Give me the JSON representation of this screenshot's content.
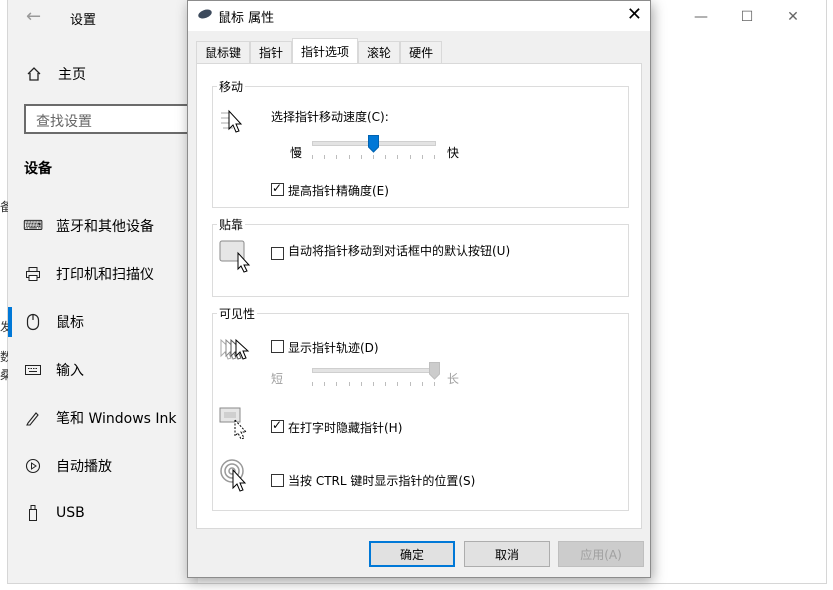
{
  "settings": {
    "title": "设置",
    "back_icon": "back-arrow-icon",
    "home_label": "主页",
    "search_placeholder": "查找设置",
    "section_heading": "设备",
    "nav_items": [
      {
        "label": "蓝牙和其他设备",
        "icon": "bluetooth-devices-icon"
      },
      {
        "label": "打印机和扫描仪",
        "icon": "printer-icon"
      },
      {
        "label": "鼠标",
        "icon": "mouse-icon"
      },
      {
        "label": "输入",
        "icon": "keyboard-icon"
      },
      {
        "label": "笔和 Windows Ink",
        "icon": "pen-icon"
      },
      {
        "label": "自动播放",
        "icon": "autoplay-icon"
      },
      {
        "label": "USB",
        "icon": "usb-icon"
      }
    ],
    "selected_item": "鼠标",
    "left_strip_fragments": [
      "备",
      "发",
      "数",
      "桑"
    ],
    "accent_color": "#0078d7"
  },
  "dialog": {
    "title": "鼠标 属性",
    "tabs": [
      "鼠标键",
      "指针",
      "指针选项",
      "滚轮",
      "硬件"
    ],
    "active_tab": "指针选项",
    "motion": {
      "group_label": "移动",
      "speed_label": "选择指针移动速度(C):",
      "slow_label": "慢",
      "fast_label": "快",
      "speed_value": 0.5,
      "precision_label": "提高指针精确度(E)",
      "precision_checked": true
    },
    "snap": {
      "group_label": "贴靠",
      "snap_label": "自动将指针移动到对话框中的默认按钮(U)",
      "snap_checked": false
    },
    "visibility": {
      "group_label": "可见性",
      "trails_label": "显示指针轨迹(D)",
      "trails_checked": false,
      "short_label": "短",
      "long_label": "长",
      "trails_value": 1.0,
      "hide_label": "在打字时隐藏指针(H)",
      "hide_checked": true,
      "ctrl_label": "当按 CTRL 键时显示指针的位置(S)",
      "ctrl_checked": false
    },
    "buttons": {
      "ok": "确定",
      "cancel": "取消",
      "apply": "应用(A)"
    }
  }
}
